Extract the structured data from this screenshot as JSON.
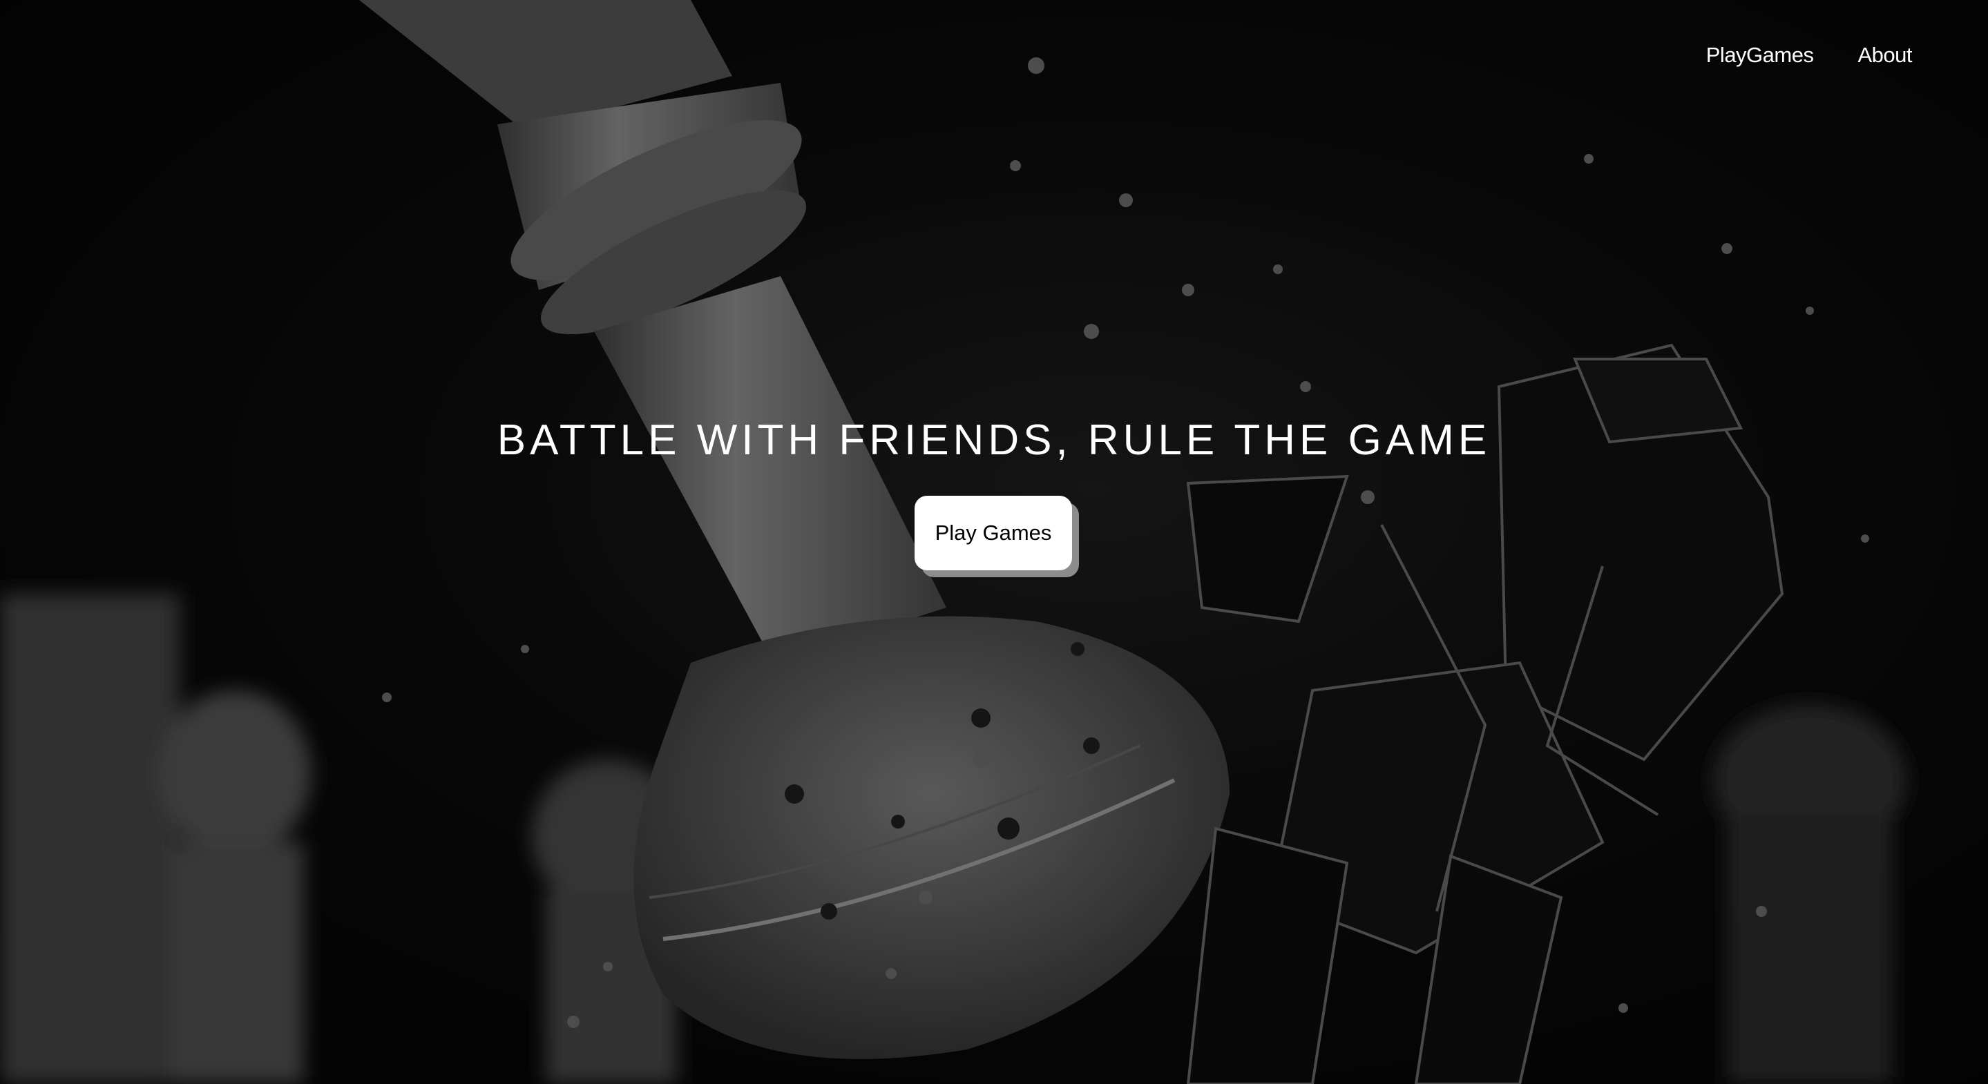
{
  "nav": {
    "items": [
      {
        "label": "PlayGames"
      },
      {
        "label": "About"
      }
    ]
  },
  "hero": {
    "title": "BATTLE WITH FRIENDS, RULE THE GAME",
    "cta_label": "Play Games"
  },
  "background": {
    "description_icon": "shattering-chess-pieces-image",
    "base_color": "#050505",
    "piece_color": "#6f6f6f"
  }
}
